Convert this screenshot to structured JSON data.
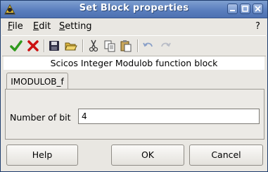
{
  "window": {
    "title": "Set Block properties"
  },
  "menubar": {
    "file": "File",
    "edit": "Edit",
    "setting": "Setting",
    "help": "?"
  },
  "toolbar": {
    "icons": [
      "ok-icon",
      "cancel-icon",
      "save-icon",
      "open-icon",
      "cut-icon",
      "copy-icon",
      "paste-icon",
      "undo-icon",
      "redo-icon"
    ]
  },
  "description": "Scicos Integer Modulob function block",
  "tab": {
    "label": "IMODULOB_f"
  },
  "form": {
    "number_of_bit_label": "Number of bit",
    "number_of_bit_value": "4"
  },
  "buttons": {
    "help": "Help",
    "ok": "OK",
    "cancel": "Cancel"
  },
  "colors": {
    "titlebar": "#5b7fbe",
    "ok_green": "#2f9a1c",
    "cancel_red": "#cc1010"
  }
}
